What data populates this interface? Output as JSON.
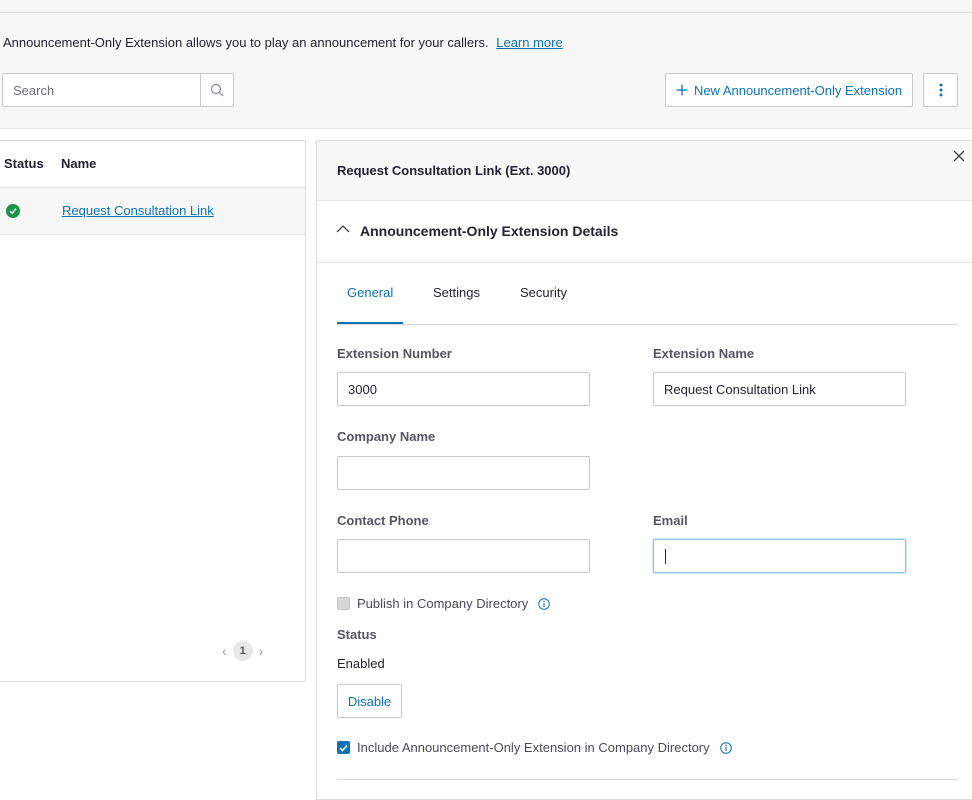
{
  "header": {
    "description": "Announcement-Only Extension allows you to play an announcement for your callers.",
    "learn_more": "Learn more",
    "search_placeholder": "Search",
    "new_button": "New Announcement-Only Extension"
  },
  "list": {
    "columns": [
      "Status",
      "Name"
    ],
    "rows": [
      {
        "status": "enabled",
        "name": "Request Consultation Link"
      }
    ],
    "pagination": {
      "current_page": "1"
    }
  },
  "detail": {
    "title": "Request Consultation Link (Ext. 3000)",
    "section_title": "Announcement-Only Extension Details",
    "tabs": [
      "General",
      "Settings",
      "Security"
    ],
    "active_tab": "General",
    "fields": {
      "extension_number": {
        "label": "Extension Number",
        "value": "3000"
      },
      "extension_name": {
        "label": "Extension Name",
        "value": "Request Consultation Link"
      },
      "company_name": {
        "label": "Company Name",
        "value": ""
      },
      "contact_phone": {
        "label": "Contact Phone",
        "value": ""
      },
      "email": {
        "label": "Email",
        "value": ""
      }
    },
    "publish_directory": {
      "label": "Publish in Company Directory",
      "checked": false
    },
    "status": {
      "label": "Status",
      "value": "Enabled",
      "button": "Disable"
    },
    "include_directory": {
      "label": "Include Announcement-Only Extension in Company Directory",
      "checked": true
    }
  },
  "colors": {
    "accent": "#0e72b5",
    "status_ok": "#1a9448",
    "background_top": "#f7f7f7"
  }
}
